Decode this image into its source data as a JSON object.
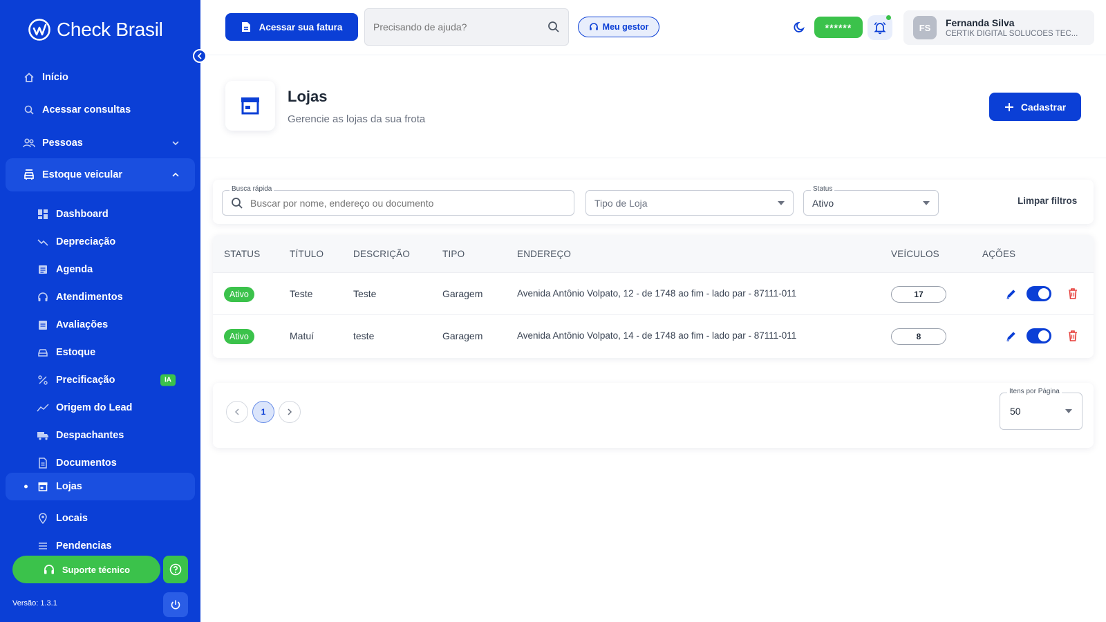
{
  "brand": {
    "name": "Check Brasil"
  },
  "sidebar": {
    "items": [
      {
        "label": "Início",
        "icon": "home-icon"
      },
      {
        "label": "Acessar consultas",
        "icon": "search-icon"
      },
      {
        "label": "Pessoas",
        "icon": "people-icon"
      },
      {
        "label": "Estoque veicular",
        "icon": "car-stock-icon"
      },
      {
        "label": "Dashboard",
        "icon": "dashboard-icon"
      },
      {
        "label": "Depreciação",
        "icon": "trend-down-icon"
      },
      {
        "label": "Agenda",
        "icon": "calendar-icon"
      },
      {
        "label": "Atendimentos",
        "icon": "headset-icon"
      },
      {
        "label": "Avaliações",
        "icon": "clipboard-icon"
      },
      {
        "label": "Estoque",
        "icon": "car-icon"
      },
      {
        "label": "Precificação",
        "icon": "percent-icon",
        "badge": "IA"
      },
      {
        "label": "Origem do Lead",
        "icon": "chart-line-icon"
      },
      {
        "label": "Despachantes",
        "icon": "truck-icon"
      },
      {
        "label": "Documentos",
        "icon": "document-icon"
      },
      {
        "label": "Lojas",
        "icon": "store-icon"
      },
      {
        "label": "Locais",
        "icon": "map-pin-icon"
      },
      {
        "label": "Pendencias",
        "icon": "list-icon"
      }
    ],
    "support_label": "Suporte técnico",
    "version": "Versão: 1.3.1"
  },
  "header": {
    "fatura_label": "Acessar sua fatura",
    "help_placeholder": "Precisando de ajuda?",
    "gestor_label": "Meu gestor",
    "masked_value": "******",
    "user": {
      "initials": "FS",
      "name": "Fernanda Silva",
      "company": "CERTIK DIGITAL SOLUCOES TEC..."
    }
  },
  "page": {
    "title": "Lojas",
    "subtitle": "Gerencie as lojas da sua frota",
    "add_label": "Cadastrar"
  },
  "filters": {
    "quick_search_label": "Busca rápida",
    "quick_search_placeholder": "Buscar por nome, endereço ou documento",
    "store_type_placeholder": "Tipo de Loja",
    "status_label": "Status",
    "status_value": "Ativo",
    "clear_label": "Limpar filtros"
  },
  "table": {
    "columns": [
      "STATUS",
      "TÍTULO",
      "DESCRIÇÃO",
      "TIPO",
      "ENDEREÇO",
      "VEÍCULOS",
      "AÇÕES"
    ],
    "rows": [
      {
        "status": "Ativo",
        "title": "Teste",
        "description": "Teste",
        "type": "Garagem",
        "address": "Avenida Antônio Volpato, 12 - de 1748 ao fim - lado par - 87111-011",
        "vehicles": "17",
        "enabled": true
      },
      {
        "status": "Ativo",
        "title": "Matuí",
        "description": "teste",
        "type": "Garagem",
        "address": "Avenida Antônio Volpato, 14 - de 1748 ao fim - lado par - 87111-011",
        "vehicles": "8",
        "enabled": true
      }
    ]
  },
  "pagination": {
    "current_page": "1",
    "per_page_label": "Itens por Página",
    "per_page_value": "50"
  },
  "colors": {
    "primary": "#0b3fd6",
    "success": "#3bc24b",
    "danger": "#e53935"
  }
}
